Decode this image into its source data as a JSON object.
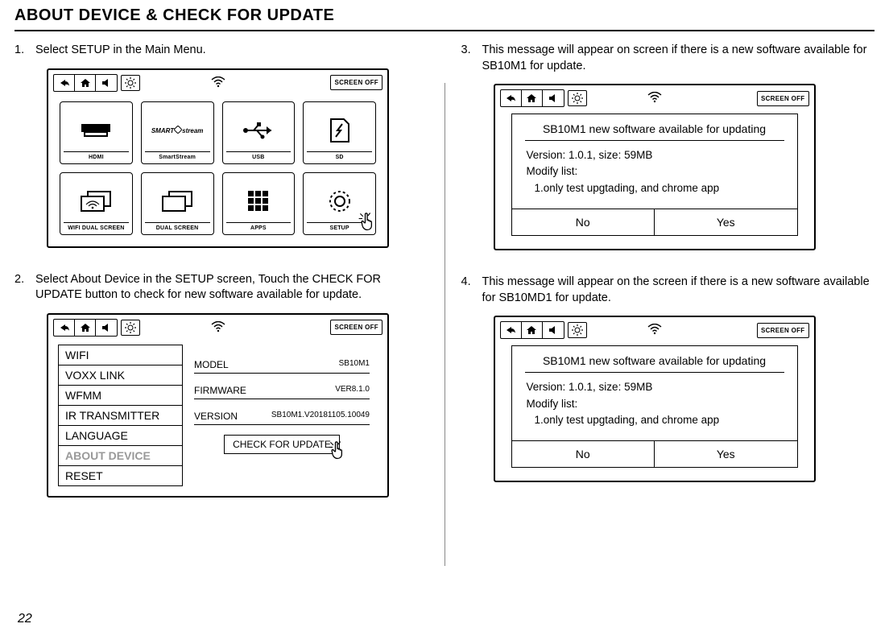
{
  "page_title": "ABOUT DEVICE & CHECK FOR UPDATE",
  "page_number": "22",
  "topbar": {
    "screen_off": "SCREEN OFF"
  },
  "steps": {
    "s1": {
      "num": "1.",
      "text": "Select SETUP in the Main Menu."
    },
    "s2": {
      "num": "2.",
      "text": "Select About Device in the SETUP screen, Touch the CHECK FOR UPDATE button to check for new software available for update."
    },
    "s3": {
      "num": "3.",
      "text": "This message will appear on screen if there is a new software available for SB10M1 for update."
    },
    "s4": {
      "num": "4.",
      "text": "This message will appear on the screen if there is a new software available for SB10MD1 for update."
    }
  },
  "main_menu": {
    "tiles": [
      {
        "label": "HDMI"
      },
      {
        "label": "SmartStream"
      },
      {
        "label": "USB"
      },
      {
        "label": "SD"
      },
      {
        "label": "WIFI DUAL SCREEN"
      },
      {
        "label": "DUAL SCREEN"
      },
      {
        "label": "APPS"
      },
      {
        "label": "SETUP"
      }
    ],
    "smartstream_logo": "SMART stream"
  },
  "setup_menu": {
    "items": [
      "WIFI",
      "VOXX LINK",
      "WFMM",
      "IR TRANSMITTER",
      "LANGUAGE",
      "ABOUT DEVICE",
      "RESET"
    ],
    "rows": {
      "model": {
        "label": "MODEL",
        "value": "SB10M1"
      },
      "firmware": {
        "label": "FIRMWARE",
        "value": "VER8.1.0"
      },
      "version": {
        "label": "VERSION",
        "value": "SB10M1.V20181105.10049"
      }
    },
    "check_update": "CHECK FOR UPDATE"
  },
  "dialog": {
    "title": "SB10M1 new software available for updating",
    "version_line": "Version: 1.0.1, size: 59MB",
    "modify_label": "Modify list:",
    "modify_item": "1.only test upgtading, and chrome app",
    "no": "No",
    "yes": "Yes"
  }
}
